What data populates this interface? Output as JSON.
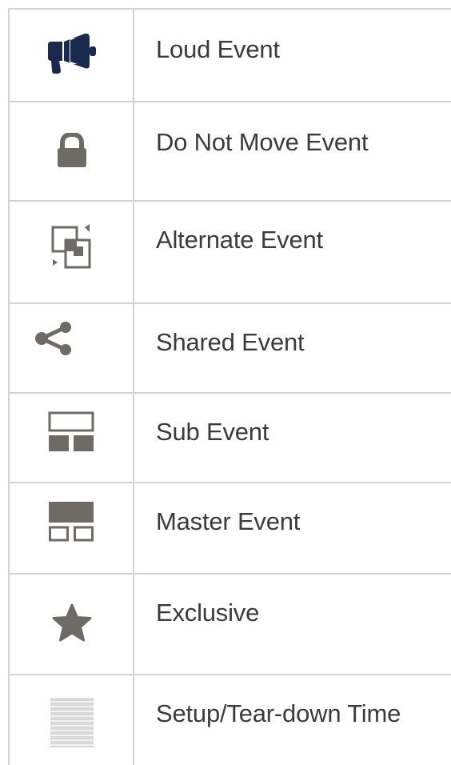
{
  "legend": {
    "rows": [
      {
        "icon": "megaphone-icon",
        "label": "Loud Event",
        "color": "#1a2a4f"
      },
      {
        "icon": "lock-icon",
        "label": "Do Not Move Event",
        "color": "#6e6a66"
      },
      {
        "icon": "alternate-icon",
        "label": "Alternate Event",
        "color": "#6e6a66"
      },
      {
        "icon": "share-icon",
        "label": "Shared Event",
        "color": "#6e6a66"
      },
      {
        "icon": "sub-event-icon",
        "label": "Sub Event",
        "color": "#6e6a66"
      },
      {
        "icon": "master-event-icon",
        "label": "Master Event",
        "color": "#6e6a66"
      },
      {
        "icon": "star-icon",
        "label": "Exclusive",
        "color": "#6e6a66"
      },
      {
        "icon": "setup-teardown-icon",
        "label": "Setup/Tear-down Time",
        "color": "#d9d9d9"
      }
    ]
  }
}
